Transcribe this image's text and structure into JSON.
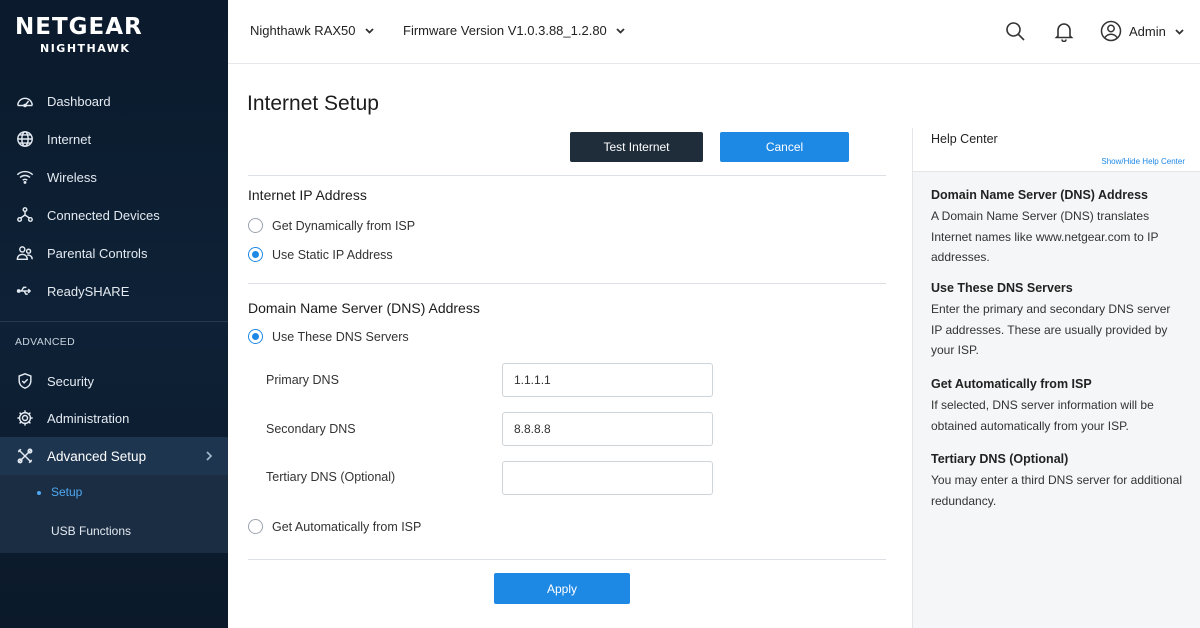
{
  "brand": {
    "name": "NETGEAR",
    "product": "NIGHTHAWK"
  },
  "nav": {
    "items": [
      {
        "label": "Dashboard",
        "icon": "dashboard-icon"
      },
      {
        "label": "Internet",
        "icon": "globe-icon"
      },
      {
        "label": "Wireless",
        "icon": "wifi-icon"
      },
      {
        "label": "Connected Devices",
        "icon": "devices-icon"
      },
      {
        "label": "Parental Controls",
        "icon": "people-icon"
      },
      {
        "label": "ReadySHARE",
        "icon": "usb-icon"
      }
    ],
    "advanced_label": "ADVANCED",
    "advanced_items": [
      {
        "label": "Security",
        "icon": "shield-icon"
      },
      {
        "label": "Administration",
        "icon": "gear-icon"
      },
      {
        "label": "Advanced Setup",
        "icon": "tools-icon"
      }
    ],
    "sub_items": [
      {
        "label": "Setup",
        "active": true
      },
      {
        "label": "USB Functions",
        "active": false
      }
    ]
  },
  "topbar": {
    "device": "Nighthawk RAX50",
    "firmware": "Firmware Version V1.0.3.88_1.2.80",
    "user": "Admin"
  },
  "main": {
    "title": "Internet Setup",
    "test_button": "Test Internet",
    "cancel_button": "Cancel",
    "ip_section": {
      "title": "Internet IP Address",
      "options": [
        {
          "label": "Get Dynamically from ISP",
          "selected": false
        },
        {
          "label": "Use Static IP Address",
          "selected": true
        }
      ]
    },
    "dns_section": {
      "title": "Domain Name Server (DNS) Address",
      "use_these": "Use These DNS Servers",
      "get_auto": "Get Automatically from ISP",
      "primary_label": "Primary DNS",
      "primary_value": "1.1.1.1",
      "secondary_label": "Secondary DNS",
      "secondary_value": "8.8.8.8",
      "tertiary_label": "Tertiary DNS (Optional)",
      "tertiary_value": ""
    },
    "apply_button": "Apply"
  },
  "help": {
    "title": "Help Center",
    "toggle": "Show/Hide Help Center",
    "sections": [
      {
        "heading": "Domain Name Server (DNS) Address",
        "body": "A Domain Name Server (DNS) translates Internet names like www.netgear.com to IP addresses."
      },
      {
        "heading": "Use These DNS Servers",
        "body": "Enter the primary and secondary DNS server IP addresses. These are usually provided by your ISP."
      },
      {
        "heading": "Get Automatically from ISP",
        "body": "If selected, DNS server information will be obtained automatically from your ISP."
      },
      {
        "heading": "Tertiary DNS (Optional)",
        "body": "You may enter a third DNS server for additional redundancy."
      }
    ]
  },
  "colors": {
    "accent": "#1e88e5",
    "sidebar": "#0e2136",
    "dark_button": "#1f2d3b"
  }
}
